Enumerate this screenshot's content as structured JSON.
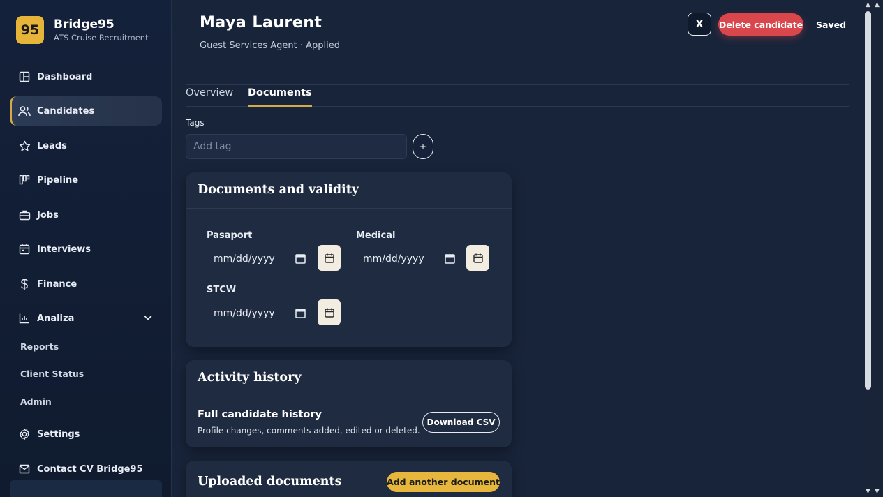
{
  "brand": {
    "logo": "95",
    "name": "Bridge95",
    "subtitle": "ATS Cruise Recruitment"
  },
  "sidebar": {
    "items": [
      {
        "label": "Dashboard",
        "icon": "dashboard-icon"
      },
      {
        "label": "Candidates",
        "icon": "users-icon",
        "active": true
      },
      {
        "label": "Leads",
        "icon": "star-icon"
      },
      {
        "label": "Pipeline",
        "icon": "kanban-icon"
      },
      {
        "label": "Jobs",
        "icon": "briefcase-icon"
      },
      {
        "label": "Interviews",
        "icon": "calendar-icon"
      },
      {
        "label": "Finance",
        "icon": "dollar-icon"
      },
      {
        "label": "Analiza",
        "icon": "chart-icon",
        "expandable": true
      }
    ],
    "subitems": [
      {
        "label": "Reports"
      },
      {
        "label": "Client Status"
      },
      {
        "label": "Admin"
      }
    ],
    "settings": {
      "label": "Settings",
      "icon": "gear-icon"
    },
    "contact": {
      "label": "Contact CV Bridge95",
      "icon": "mail-icon"
    }
  },
  "candidate": {
    "name": "Maya Laurent",
    "subtitle": "Guest Services Agent · Applied"
  },
  "header": {
    "close_label": "X",
    "delete_label": "Delete candidate",
    "status": "Saved"
  },
  "tabs": [
    {
      "label": "Overview"
    },
    {
      "label": "Documents",
      "active": true
    }
  ],
  "tags": {
    "label": "Tags",
    "placeholder": "Add tag",
    "add_label": "+"
  },
  "documents_card": {
    "title": "Documents and validity",
    "fields": [
      {
        "label": "Pasaport",
        "value": "mm/dd/yyyy"
      },
      {
        "label": "Medical",
        "value": "mm/dd/yyyy"
      },
      {
        "label": "STCW",
        "value": "mm/dd/yyyy"
      }
    ]
  },
  "activity_card": {
    "title": "Activity history",
    "subtitle": "Full candidate history",
    "description": "Profile changes, comments added, edited or deleted.",
    "download_label": "Download CSV"
  },
  "uploaded_card": {
    "title": "Uploaded documents",
    "add_label": "Add another document"
  },
  "colors": {
    "accent": "#e6b73c",
    "danger": "#d9464b",
    "background": "#18243a",
    "card": "#1f2b40"
  }
}
